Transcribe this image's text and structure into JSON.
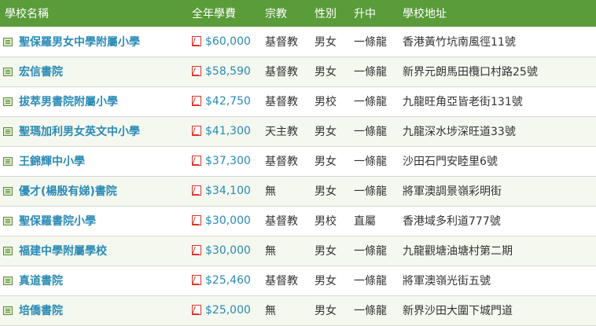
{
  "header": {
    "name": "學校名稱",
    "fee": "全年學費",
    "religion": "宗教",
    "gender": "性別",
    "promotion": "升中",
    "address": "學校地址"
  },
  "rows": [
    {
      "name": "聖保羅男女中學附屬小學",
      "fee": "$60,000",
      "religion": "基督教",
      "gender": "男女",
      "promotion": "一條龍",
      "address": "香港黃竹坑南風徑11號"
    },
    {
      "name": "宏信書院",
      "fee": "$58,590",
      "religion": "基督教",
      "gender": "男女",
      "promotion": "一條龍",
      "address": "新界元朗馬田欖口村路25號"
    },
    {
      "name": "拔萃男書院附屬小學",
      "fee": "$42,750",
      "religion": "基督教",
      "gender": "男校",
      "promotion": "一條龍",
      "address": "九龍旺角亞皆老街131號"
    },
    {
      "name": "聖瑪加利男女英文中小學",
      "fee": "$41,300",
      "religion": "天主教",
      "gender": "男女",
      "promotion": "一條龍",
      "address": "九龍深水埗深旺道33號"
    },
    {
      "name": "王錦輝中小學",
      "fee": "$37,300",
      "religion": "基督教",
      "gender": "男女",
      "promotion": "一條龍",
      "address": "沙田石門安睦里6號"
    },
    {
      "name": "優才(楊殷有娣)書院",
      "fee": "$34,100",
      "religion": "無",
      "gender": "男女",
      "promotion": "一條龍",
      "address": "將軍澳調景嶺彩明街"
    },
    {
      "name": "聖保羅書院小學",
      "fee": "$30,000",
      "religion": "基督教",
      "gender": "男校",
      "promotion": "直屬",
      "address": "香港域多利道777號"
    },
    {
      "name": "福建中學附屬學校",
      "fee": "$30,000",
      "religion": "無",
      "gender": "男女",
      "promotion": "一條龍",
      "address": "九龍觀塘油塘村第二期"
    },
    {
      "name": "真道書院",
      "fee": "$25,460",
      "religion": "基督教",
      "gender": "男女",
      "promotion": "一條龍",
      "address": "將軍澳嶺光街五號"
    },
    {
      "name": "培僑書院",
      "fee": "$25,000",
      "religion": "無",
      "gender": "男女",
      "promotion": "一條龍",
      "address": "新界沙田大圍下城門道"
    }
  ]
}
